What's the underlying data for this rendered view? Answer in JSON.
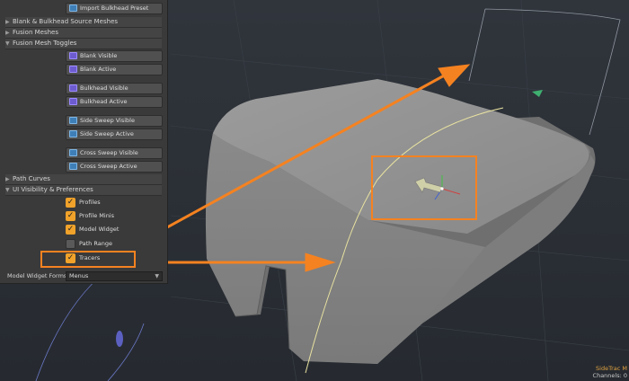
{
  "panel": {
    "import_button": "Import Bulkhead Preset",
    "sections": {
      "source_meshes": "Blank & Bulkhead Source Meshes",
      "fusion_meshes": "Fusion Meshes",
      "fusion_toggles": "Fusion Mesh Toggles",
      "path_curves": "Path Curves",
      "ui_visibility": "UI Visibility & Preferences"
    },
    "buttons": {
      "blank_visible": "Blank Visible",
      "blank_active": "Blank Active",
      "bulkhead_visible": "Bulkhead Visible",
      "bulkhead_active": "Bulkhead Active",
      "side_sweep_visible": "Side Sweep Visible",
      "side_sweep_active": "Side Sweep Active",
      "cross_sweep_visible": "Cross Sweep Visible",
      "cross_sweep_active": "Cross Sweep Active"
    },
    "checkboxes": {
      "profiles": "Profiles",
      "profile_minis": "Profile Minis",
      "model_widget": "Model Widget",
      "path_range": "Path Range",
      "tracers": "Tracers"
    },
    "checkbox_states": {
      "profiles": true,
      "profile_minis": true,
      "model_widget": true,
      "path_range": false,
      "tracers": true
    },
    "model_widget_forms": {
      "label": "Model Widget Forms:",
      "value": "Menus"
    }
  },
  "status": {
    "line1": "SideTrac M",
    "line2": "Channels: 0"
  },
  "colors": {
    "accent": "#f58220",
    "checkbox_on": "#f0a22a",
    "status_text": "#e0a040"
  }
}
